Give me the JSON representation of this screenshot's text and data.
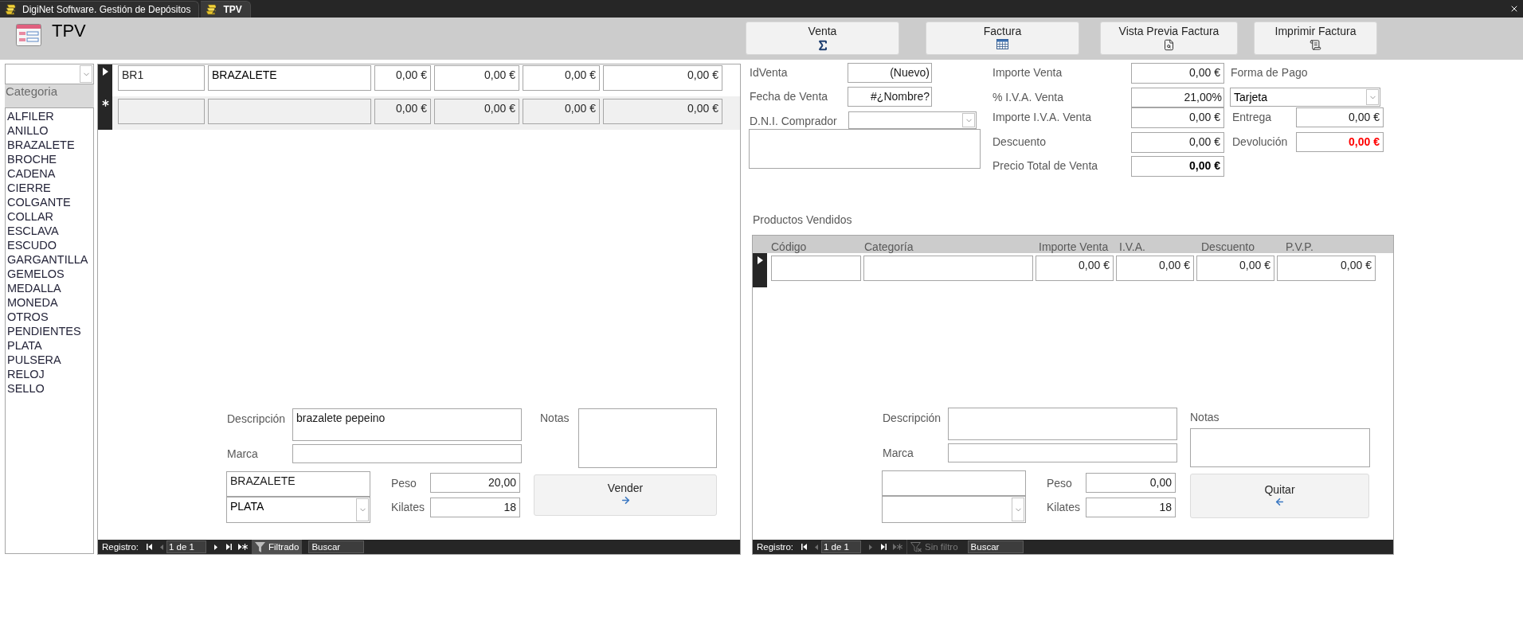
{
  "tabs": [
    {
      "label": "DigiNet Software. Gestión de Depósitos",
      "selected": false
    },
    {
      "label": "TPV",
      "selected": true
    }
  ],
  "header": {
    "title": "TPV",
    "buttons": [
      {
        "label": "Venta"
      },
      {
        "label": "Factura"
      },
      {
        "label": "Vista Previa Factura"
      },
      {
        "label": "Imprimir Factura"
      }
    ]
  },
  "category_filter": {
    "label": "Categoria",
    "items": [
      {
        "label": "ALFILER",
        "selected": false
      },
      {
        "label": "ANILLO",
        "selected": false
      },
      {
        "label": "BRAZALETE",
        "selected": false
      },
      {
        "label": "BROCHE",
        "selected": false
      },
      {
        "label": "CADENA",
        "selected": false
      },
      {
        "label": "CIERRE",
        "selected": false
      },
      {
        "label": "COLGANTE",
        "selected": false
      },
      {
        "label": "COLLAR",
        "selected": false
      },
      {
        "label": "ESCLAVA",
        "selected": false
      },
      {
        "label": "ESCUDO",
        "selected": false
      },
      {
        "label": "GARGANTILLA",
        "selected": false
      },
      {
        "label": "GEMELOS",
        "selected": false
      },
      {
        "label": "MEDALLA",
        "selected": false
      },
      {
        "label": "MONEDA",
        "selected": false
      },
      {
        "label": "OTROS",
        "selected": false
      },
      {
        "label": "PENDIENTES",
        "selected": false
      },
      {
        "label": "PLATA",
        "selected": false
      },
      {
        "label": "PULSERA",
        "selected": false
      },
      {
        "label": "RELOJ",
        "selected": false
      },
      {
        "label": "SELLO",
        "selected": false
      }
    ]
  },
  "articles": {
    "rows": [
      {
        "kind": "current",
        "cells": {
          "column_1": "BR1",
          "column_2": "BRAZALETE",
          "column_3": "0,00 €",
          "column_4": "0,00 €",
          "column_5": "0,00 €",
          "column_6": "0,00 €"
        }
      },
      {
        "kind": "new",
        "cells": {
          "column_3": "0,00 €",
          "column_4": "0,00 €",
          "column_5": "0,00 €",
          "column_6": "0,00 €"
        }
      }
    ],
    "detail": {
      "description": {
        "label": "Descripción",
        "value": "brazalete pepeino"
      },
      "brand": {
        "label": "Marca"
      },
      "notes": {
        "label": "Notas"
      },
      "category": {
        "value": "BRAZALETE"
      },
      "material": {
        "value": "PLATA"
      },
      "weight": {
        "label": "Peso",
        "value": "20,00"
      },
      "carats": {
        "label": "Kilates",
        "value": "18"
      },
      "action": {
        "label": "Vender",
        "kind": "add"
      }
    },
    "navigation": {
      "label": "Registro:",
      "buttons": [
        {
          "kind": "first",
          "disabled": false
        },
        {
          "kind": "previous",
          "disabled": true
        },
        {
          "kind": "next",
          "disabled": false
        },
        {
          "kind": "last",
          "disabled": false
        },
        {
          "kind": "new",
          "disabled": false
        }
      ],
      "position": "1 de 1",
      "filter": {
        "label": "Filtrado",
        "filtered": true
      },
      "search": {
        "placeholder": "Buscar"
      }
    }
  },
  "sale": {
    "id_venta": {
      "label": "IdVenta",
      "value": "(Nuevo)"
    },
    "fecha_venta": {
      "label": "Fecha de Venta",
      "value": "#¿Nombre?"
    },
    "dni_comprador": {
      "label": "D.N.I. Comprador"
    },
    "importe_venta": {
      "label": "Importe Venta",
      "value": "0,00 €"
    },
    "iva": {
      "label": "% I.V.A. Venta",
      "value": "21,00%"
    },
    "importe_iva": {
      "label": "Importe I.V.A. Venta",
      "value": "0,00 €"
    },
    "descuento": {
      "label": "Descuento",
      "value": "0,00 €"
    },
    "precio_total": {
      "label": "Precio Total de Venta",
      "value": "0,00 €"
    },
    "forma_pago": {
      "label": "Forma de Pago",
      "value": "Tarjeta"
    },
    "entrega": {
      "label": "Entrega",
      "value": "0,00 €"
    },
    "devolucion": {
      "label": "Devolución",
      "value": "0,00 €"
    }
  },
  "sold_products": {
    "title": "Productos Vendidos",
    "columns": [
      "Código",
      "Categoría",
      "Importe Venta",
      "I.V.A.",
      "Descuento",
      "P.V.P."
    ],
    "rows": [
      {
        "kind": "current",
        "cells": {
          "importe_venta": "0,00 €",
          "iva": "0,00 €",
          "descuento": "0,00 €",
          "pvp": "0,00 €"
        }
      }
    ],
    "detail": {
      "description": {
        "label": "Descripción"
      },
      "brand": {
        "label": "Marca"
      },
      "notes": {
        "label": "Notas"
      },
      "weight": {
        "label": "Peso",
        "value": "0,00"
      },
      "carats": {
        "label": "Kilates",
        "value": "18"
      },
      "action": {
        "label": "Quitar",
        "kind": "remove"
      }
    },
    "navigation": {
      "label": "Registro:",
      "buttons": [
        {
          "kind": "first",
          "disabled": false
        },
        {
          "kind": "previous",
          "disabled": true
        },
        {
          "kind": "next",
          "disabled": true
        },
        {
          "kind": "last",
          "disabled": false
        },
        {
          "kind": "new",
          "disabled": true
        }
      ],
      "position": "1 de 1",
      "filter": {
        "label": "Sin filtro",
        "filtered": false
      },
      "search": {
        "placeholder": "Buscar"
      }
    }
  }
}
